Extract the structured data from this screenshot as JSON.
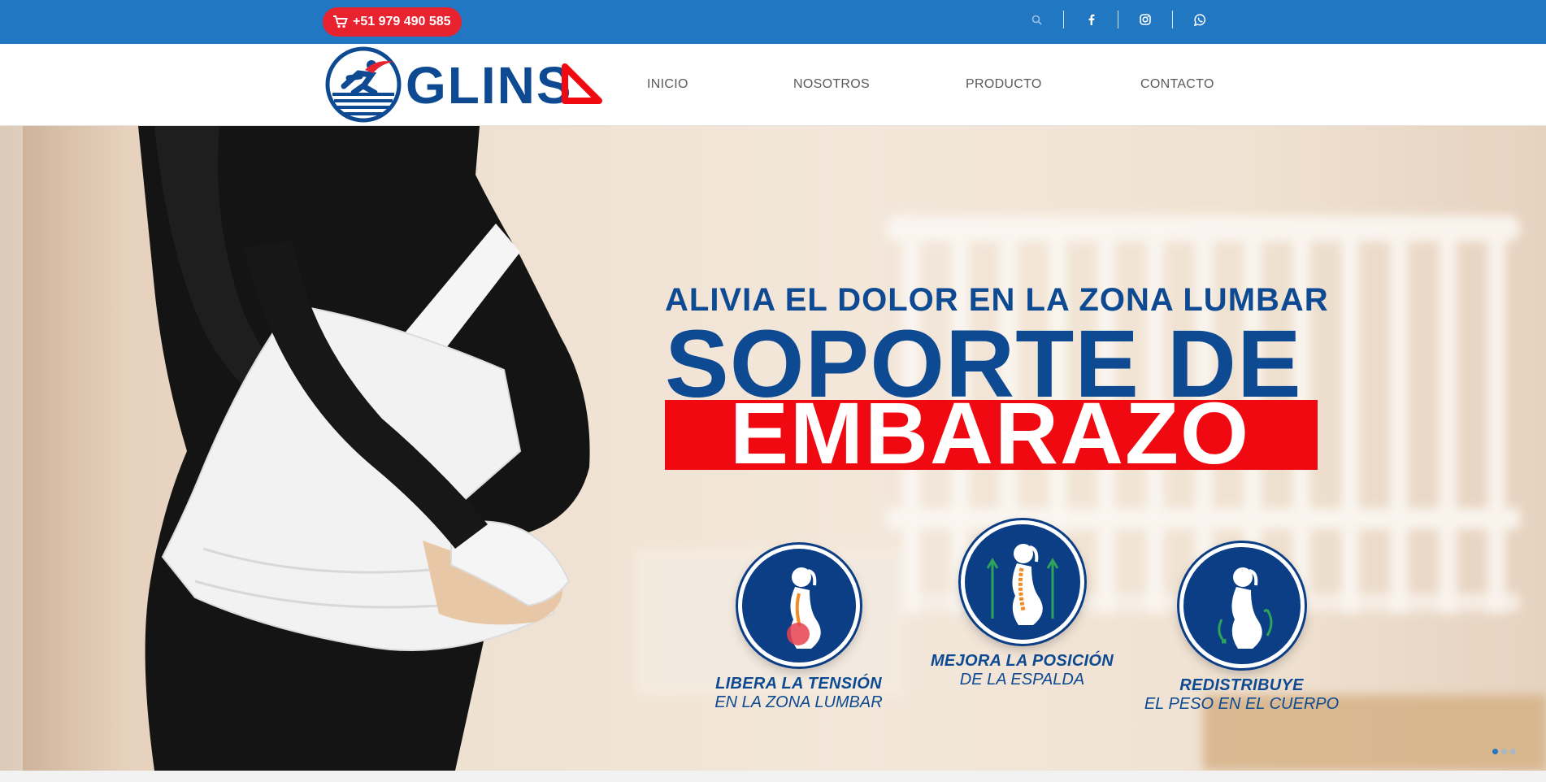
{
  "topbar": {
    "phone": "+51 979 490 585",
    "icons": [
      "search-icon",
      "facebook-icon",
      "instagram-icon",
      "whatsapp-icon"
    ]
  },
  "brand": {
    "name": "GLINSA"
  },
  "nav": [
    {
      "label": "INICIO"
    },
    {
      "label": "NOSOTROS"
    },
    {
      "label": "PRODUCTO"
    },
    {
      "label": "CONTACTO"
    }
  ],
  "hero": {
    "line1": "ALIVIA EL DOLOR EN LA ZONA LUMBAR",
    "line2": "SOPORTE DE",
    "line3": "EMBARAZO",
    "benefits": [
      {
        "title": "LIBERA LA TENSIÓN",
        "subtitle": "EN LA ZONA LUMBAR"
      },
      {
        "title": "MEJORA LA POSICIÓN",
        "subtitle": "DE LA ESPALDA"
      },
      {
        "title": "REDISTRIBUYE",
        "subtitle": "EL PESO EN EL CUERPO"
      }
    ],
    "slides": 3,
    "active_slide": 1
  },
  "colors": {
    "topbar": "#2277c2",
    "brand_blue": "#0d4a92",
    "brand_red": "#f10912",
    "phone_pill": "#e8222f"
  }
}
